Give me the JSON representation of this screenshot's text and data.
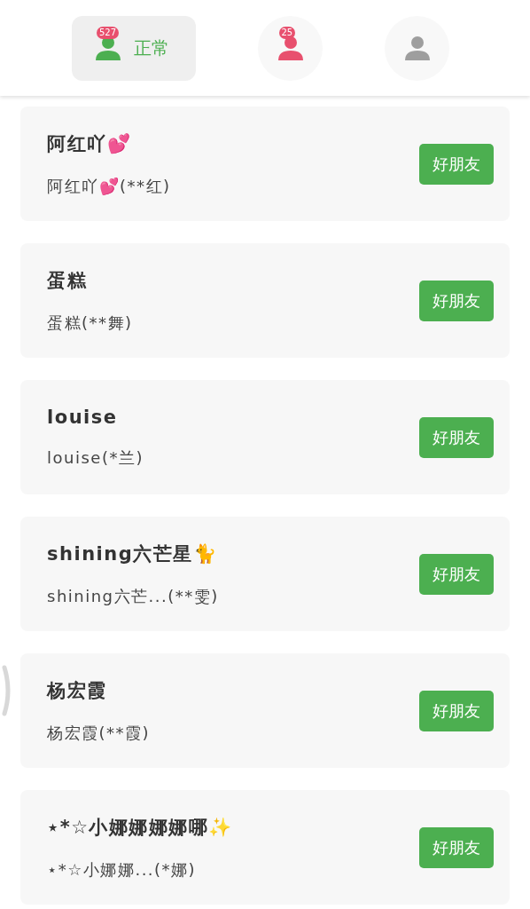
{
  "tabs": [
    {
      "label": "正常",
      "badge": "527",
      "color": "#4caf50",
      "selected": true
    },
    {
      "badge": "25",
      "color": "#e8506e",
      "selected": false
    },
    {
      "color": "#9e9e9e",
      "selected": false
    }
  ],
  "friends": [
    {
      "name": "阿红吖💕",
      "detail": "阿红吖💕(**红)",
      "button": "好朋友"
    },
    {
      "name": "蛋糕",
      "detail": "蛋糕(**舞)",
      "button": "好朋友"
    },
    {
      "name": "louise",
      "detail": "louise(*兰)",
      "button": "好朋友"
    },
    {
      "name": "shining六芒星🐈",
      "detail": "shining六芒...(**雯)",
      "button": "好朋友"
    },
    {
      "name": "杨宏霞",
      "detail": "杨宏霞(**霞)",
      "button": "好朋友"
    },
    {
      "name": "⋆*☆小娜娜娜娜哪✨",
      "detail": "⋆*☆小娜娜...(*娜)",
      "button": "好朋友"
    }
  ]
}
